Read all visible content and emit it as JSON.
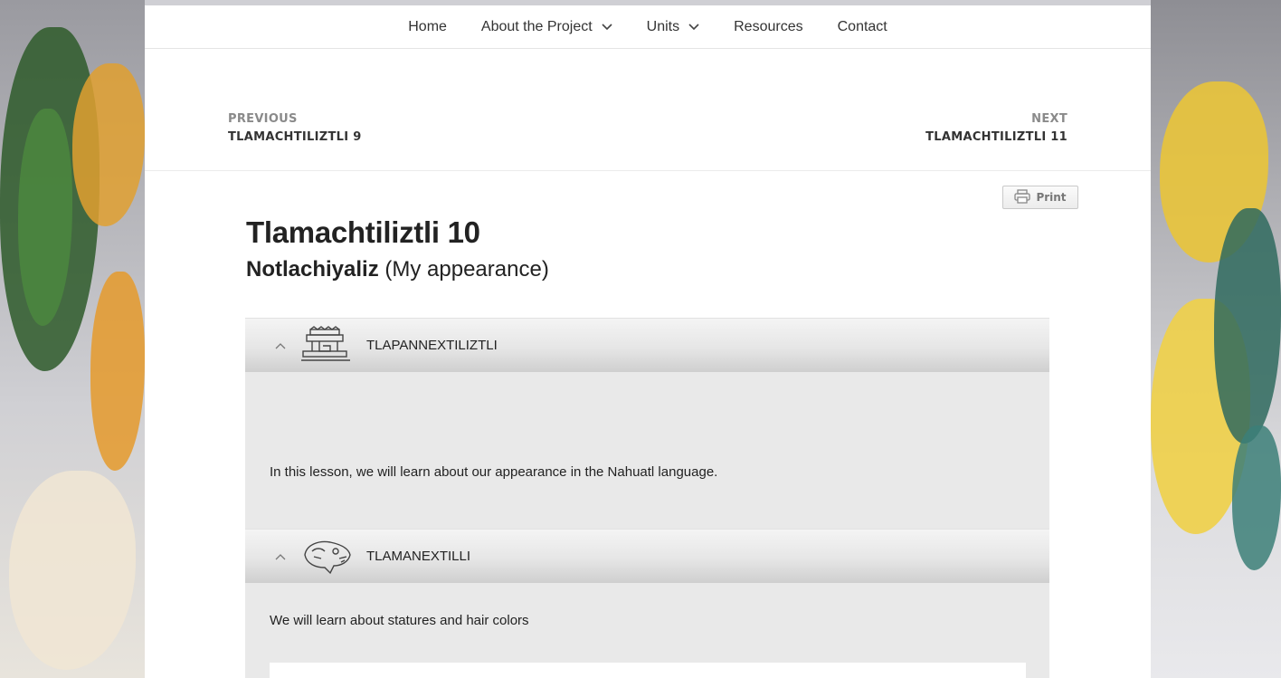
{
  "nav": {
    "items": [
      {
        "label": "Home",
        "dropdown": false
      },
      {
        "label": "About the Project",
        "dropdown": true
      },
      {
        "label": "Units",
        "dropdown": true
      },
      {
        "label": "Resources",
        "dropdown": false
      },
      {
        "label": "Contact",
        "dropdown": false
      }
    ]
  },
  "postnav": {
    "prev_kicker": "PREVIOUS",
    "prev_title": "TLAMACHTILIZTLI 9",
    "next_kicker": "NEXT",
    "next_title": "TLAMACHTILIZTLI 11"
  },
  "print_label": "Print",
  "page": {
    "title": "Tlamachtiliztli 10",
    "subtitle_bold": "Notlachiyaliz",
    "subtitle_rest": "(My appearance)"
  },
  "accordion": [
    {
      "title": "TLAPANNEXTILIZTLI",
      "icon": "temple-glyph-icon",
      "body": "In this lesson, we will learn about our appearance in the Nahuatl language."
    },
    {
      "title": "TLAMANEXTILLI",
      "icon": "animal-glyph-icon",
      "body": "We will learn about statures and hair colors"
    }
  ],
  "colors": {
    "accent_text": "#222222",
    "muted": "#8a8a8a",
    "panel": "#e9e9e9"
  }
}
